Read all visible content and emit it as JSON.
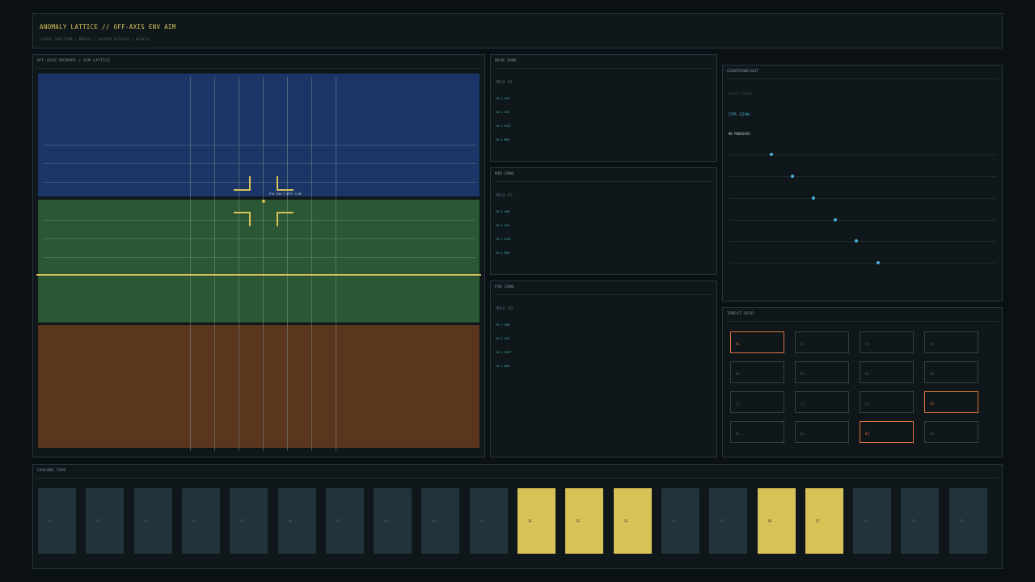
{
  "header": {
    "title": "ANOMALY LATTICE  //  OFF-AXIS ENV AIM",
    "subtitle": "SIGNAL SPECTRUM  /  NEBULA  /  HAZARD REFRESH  /  NEOVIA"
  },
  "aim": {
    "title": "OFF-AXIS PRIMARY  /  AIM LATTICE",
    "readout": "PIX 3H4.7  OFFS 3.RE",
    "colors": {
      "upper": "#1b3566",
      "middle": "#2b5734",
      "lower": "#5a361f",
      "reticle": "#d8c15a"
    }
  },
  "zones": [
    {
      "title": "NEAR ZONE",
      "hold": "HOLD 81",
      "items": [
        "PA.3 UHB",
        "PA.3 SHF",
        "PA.3 RSEF",
        "PA.4 WRN"
      ]
    },
    {
      "title": "MID ZONE",
      "hold": "HOLD 87",
      "items": [
        "PA.3 UHB",
        "PA.3 SHF",
        "PA.3 RSEF",
        "PA.4 WRN"
      ]
    },
    {
      "title": "FAR ZONE",
      "hold": "HOLD 89",
      "items": [
        "PA.3 UHB",
        "PA.3 SHF",
        "PA.3 RSEF",
        "PA.4 WRN"
      ]
    }
  ],
  "counterweight": {
    "title": "COUNTERWEIGHT",
    "select_label": "SELECT COUNTER",
    "cpa": "CPA 224m",
    "maneuver": "NO MANEUVER",
    "dot_positions": [
      0.15,
      0.23,
      0.31,
      0.39,
      0.47,
      0.55
    ]
  },
  "threat_grid": {
    "title": "THREAT GRID",
    "cells": [
      {
        "label": "A1",
        "active": true
      },
      {
        "label": "A2",
        "active": false
      },
      {
        "label": "A3",
        "active": false
      },
      {
        "label": "A4",
        "active": false
      },
      {
        "label": "B1",
        "active": false
      },
      {
        "label": "B2",
        "active": false
      },
      {
        "label": "B3",
        "active": false
      },
      {
        "label": "B4",
        "active": false
      },
      {
        "label": "C1",
        "active": false
      },
      {
        "label": "C2",
        "active": false
      },
      {
        "label": "C3",
        "active": false
      },
      {
        "label": "C4",
        "active": true
      },
      {
        "label": "D1",
        "active": false
      },
      {
        "label": "D2",
        "active": false
      },
      {
        "label": "D3",
        "active": true
      },
      {
        "label": "D4",
        "active": false
      }
    ]
  },
  "cascade": {
    "title": "CASCADE TAPE",
    "cells": [
      {
        "label": "01",
        "on": false
      },
      {
        "label": "02",
        "on": false
      },
      {
        "label": "03",
        "on": false
      },
      {
        "label": "04",
        "on": false
      },
      {
        "label": "05",
        "on": false
      },
      {
        "label": "06",
        "on": false
      },
      {
        "label": "07",
        "on": false
      },
      {
        "label": "08",
        "on": false
      },
      {
        "label": "09",
        "on": false
      },
      {
        "label": "10",
        "on": false
      },
      {
        "label": "11",
        "on": true
      },
      {
        "label": "12",
        "on": true
      },
      {
        "label": "13",
        "on": true
      },
      {
        "label": "14",
        "on": false
      },
      {
        "label": "15",
        "on": false
      },
      {
        "label": "16",
        "on": true
      },
      {
        "label": "17",
        "on": true
      },
      {
        "label": "18",
        "on": false
      },
      {
        "label": "19",
        "on": false
      },
      {
        "label": "20",
        "on": false
      }
    ]
  }
}
